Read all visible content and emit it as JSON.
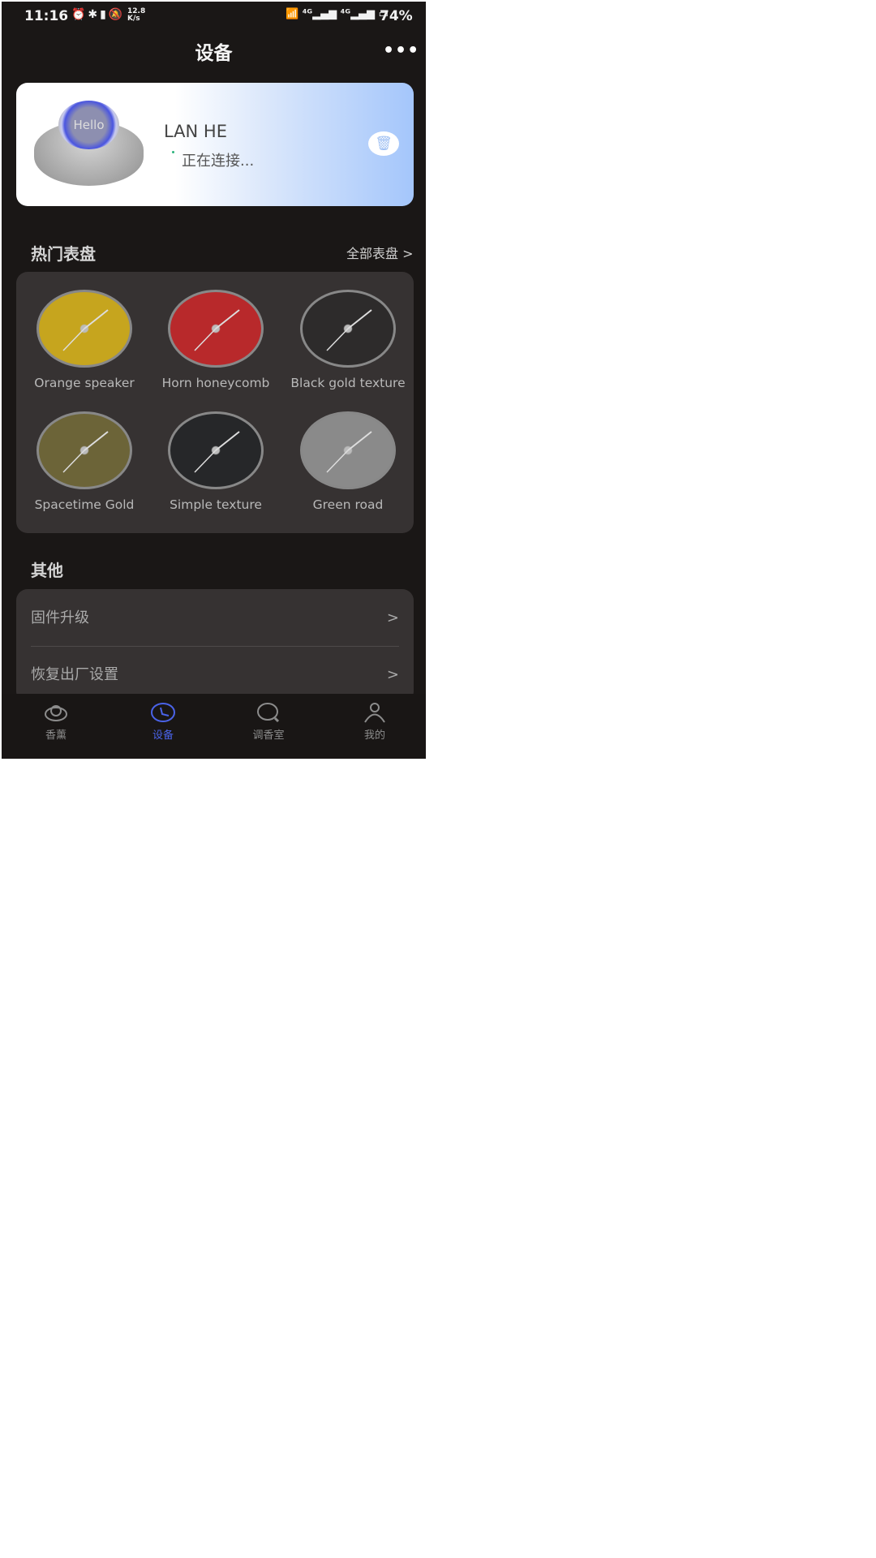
{
  "status_bar": {
    "time": "11:16",
    "net_speed": "12.8 K/s",
    "battery": "74%",
    "icons": [
      "alarm-icon",
      "bluetooth-icon",
      "battery-small-icon",
      "mute-icon",
      "wifi-icon",
      "signal-4g-icon",
      "signal-4g-icon",
      "battery-icon"
    ]
  },
  "header": {
    "title": "设备",
    "more": "•••"
  },
  "device": {
    "image_text": "Hello",
    "name": "LAN HE",
    "status": "正在连接...",
    "delete_icon": "trash-icon"
  },
  "hot_faces": {
    "title": "热门表盘",
    "all_link": "全部表盘 >",
    "items": [
      {
        "label": "Orange speaker",
        "color": "#c6a51e"
      },
      {
        "label": "Horn honeycomb",
        "color": "#b8292b"
      },
      {
        "label": "Black gold texture",
        "color": "#2d2b2b"
      },
      {
        "label": "Spacetime Gold",
        "color": "#6c6438"
      },
      {
        "label": "Simple texture",
        "color": "#262729"
      },
      {
        "label": "Green road",
        "color": "#8a8a8a"
      }
    ]
  },
  "other": {
    "title": "其他",
    "items": [
      {
        "label": "固件升级",
        "chevron": ">"
      },
      {
        "label": "恢复出厂设置",
        "chevron": ">"
      }
    ]
  },
  "nav": {
    "active_color": "#4a63e8",
    "tabs": [
      {
        "label": "香薰",
        "icon": "diffuser-icon"
      },
      {
        "label": "设备",
        "icon": "clock-icon",
        "active": true
      },
      {
        "label": "调香室",
        "icon": "search-icon"
      },
      {
        "label": "我的",
        "icon": "person-icon"
      }
    ]
  }
}
